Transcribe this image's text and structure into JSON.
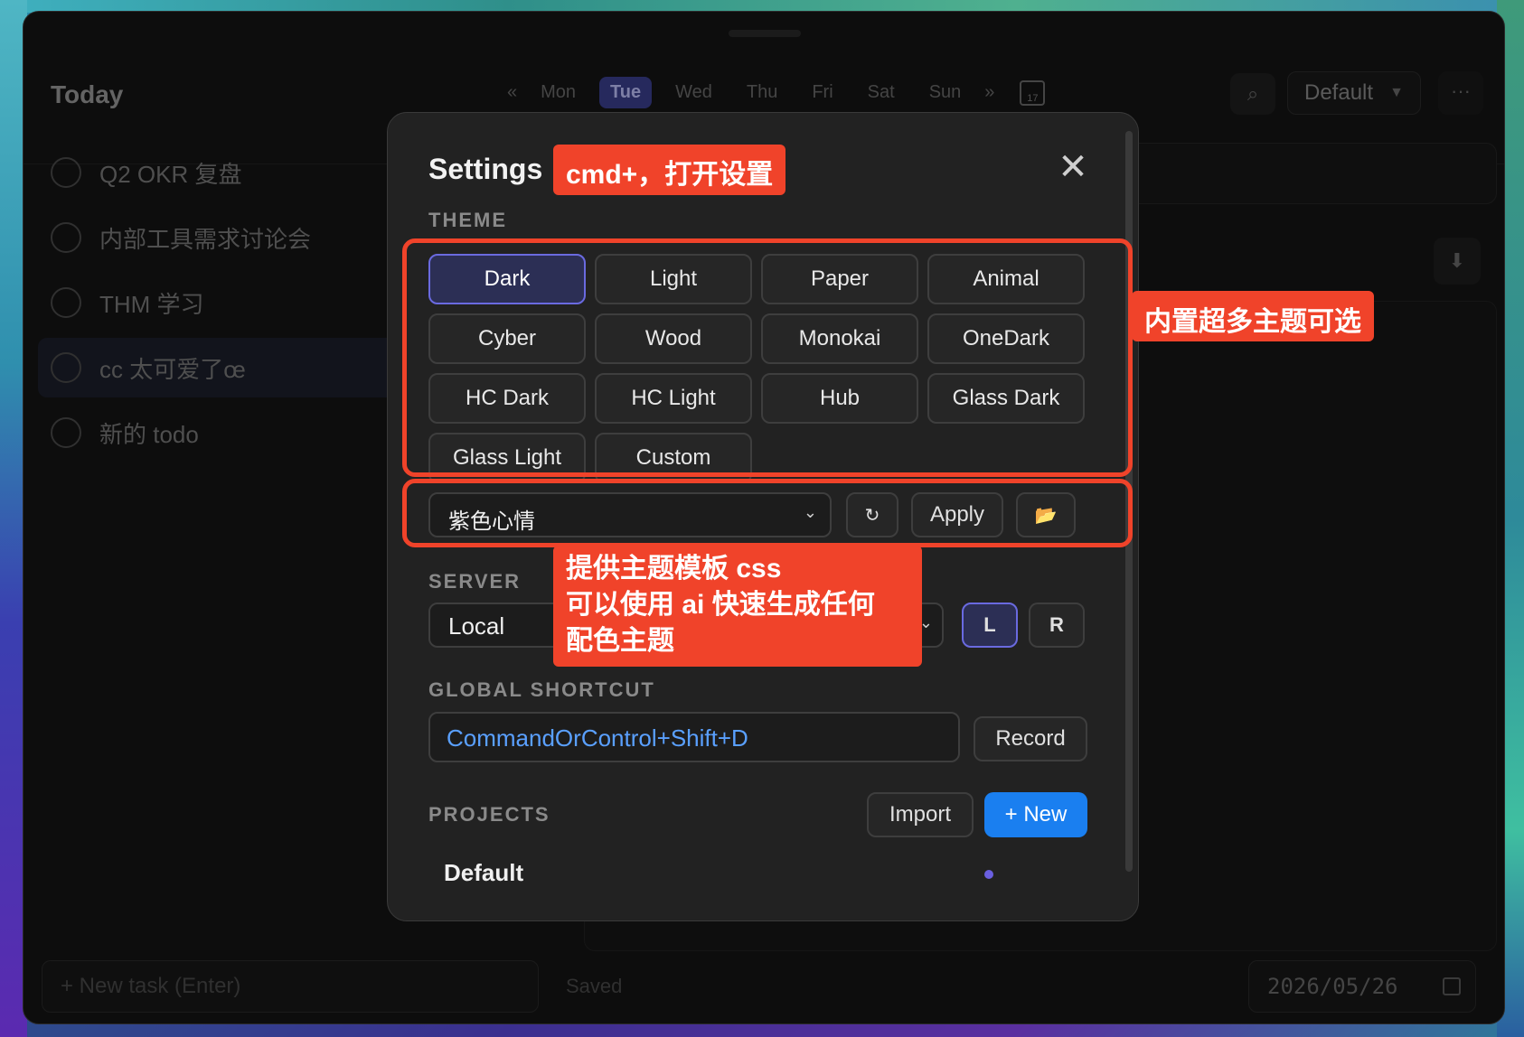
{
  "app": {
    "title": "Today",
    "week_prev": "«",
    "week_next": "»",
    "days": [
      {
        "label": "Mon",
        "active": false
      },
      {
        "label": "Tue",
        "active": true
      },
      {
        "label": "Wed",
        "active": false
      },
      {
        "label": "Thu",
        "active": false
      },
      {
        "label": "Fri",
        "active": false
      },
      {
        "label": "Sat",
        "active": false
      },
      {
        "label": "Sun",
        "active": false
      }
    ],
    "calendar_day": "17",
    "project_select": "Default",
    "more_label": "···"
  },
  "tasks": [
    {
      "label": "Q2 OKR 复盘"
    },
    {
      "label": "内部工具需求讨论会"
    },
    {
      "label": "THM 学习"
    },
    {
      "label": "cc 太可爱了œ"
    },
    {
      "label": "新的 todo"
    }
  ],
  "bottom": {
    "new_task_placeholder": "+ New task (Enter)",
    "saved_text": "Saved",
    "date_value": "2026/05/26"
  },
  "settings": {
    "title": "Settings",
    "close_label": "✕",
    "theme_label": "THEME",
    "themes": [
      {
        "label": "Dark",
        "active": true
      },
      {
        "label": "Light",
        "active": false
      },
      {
        "label": "Paper",
        "active": false
      },
      {
        "label": "Animal",
        "active": false
      },
      {
        "label": "Cyber",
        "active": false
      },
      {
        "label": "Wood",
        "active": false
      },
      {
        "label": "Monokai",
        "active": false
      },
      {
        "label": "OneDark",
        "active": false
      },
      {
        "label": "HC Dark",
        "active": false
      },
      {
        "label": "HC Light",
        "active": false
      },
      {
        "label": "Hub",
        "active": false
      },
      {
        "label": "Glass Dark",
        "active": false
      },
      {
        "label": "Glass Light",
        "active": false
      },
      {
        "label": "Custom",
        "active": false
      }
    ],
    "template_select": "紫色心情",
    "refresh_label": "↻",
    "apply_label": "Apply",
    "folder_label": "📂",
    "server_label": "SERVER",
    "server_select": "Local",
    "server_l": "L",
    "server_r": "R",
    "shortcut_label": "GLOBAL SHORTCUT",
    "shortcut_value": "CommandOrControl+Shift+D",
    "record_label": "Record",
    "projects_label": "PROJECTS",
    "import_label": "Import",
    "new_label": "+ New",
    "project_items": [
      "Default"
    ]
  },
  "annotations": {
    "shortcut_note": "cmd+，打开设置",
    "themes_note": "内置超多主题可选",
    "template_note_1": "提供主题模板 css",
    "template_note_2": "可以使用 ai 快速生成任何",
    "template_note_3": "配色主题"
  },
  "colors": {
    "accent": "#6a6ae0",
    "primary_button": "#1a7ff0",
    "annotation": "#f0432a",
    "shortcut_text": "#5aa0ff"
  }
}
